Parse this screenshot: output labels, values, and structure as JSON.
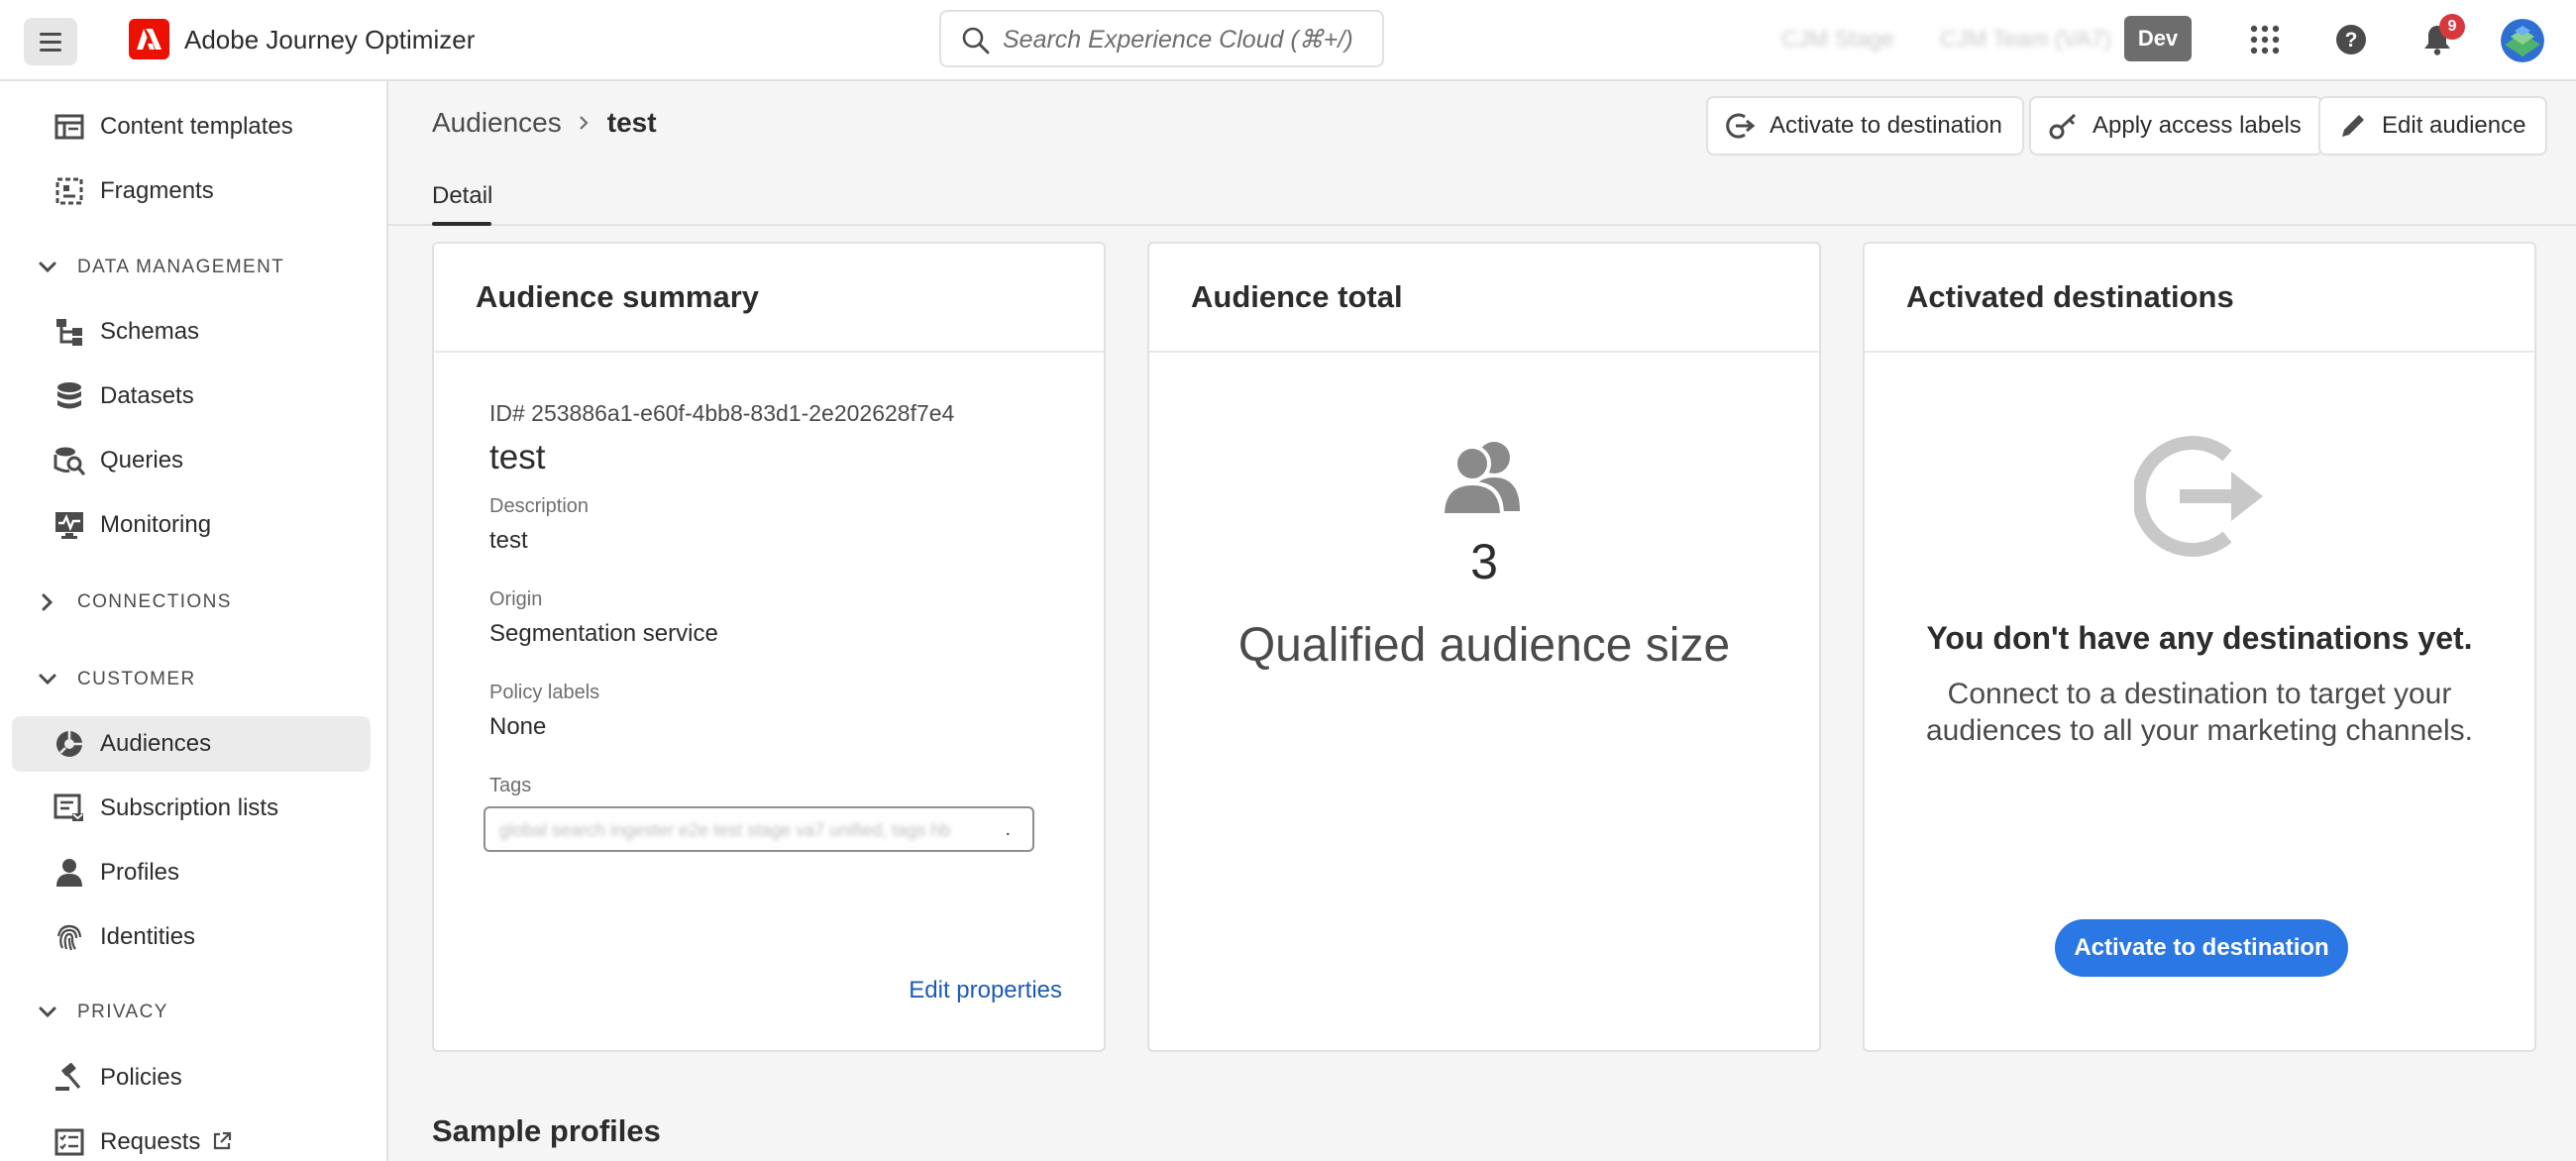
{
  "app": {
    "name": "Adobe Journey Optimizer"
  },
  "topbar": {
    "search_placeholder": "Search Experience Cloud (⌘+/)",
    "org_primary": "CJM Stage",
    "org_secondary": "CJM Team (VA7)",
    "environment": "Dev",
    "notification_count": "9",
    "icons": [
      "menu-icon",
      "adobe-logo-icon",
      "search-icon",
      "apps-grid-icon",
      "help-icon",
      "notification-bell-icon",
      "user-avatar-icon"
    ]
  },
  "sidebar": {
    "items_top": [
      {
        "label": "Content templates",
        "icon": "content-templates-icon"
      },
      {
        "label": "Fragments",
        "icon": "fragments-icon"
      }
    ],
    "sections": [
      {
        "label": "DATA MANAGEMENT",
        "expanded": true
      },
      {
        "label": "CONNECTIONS",
        "expanded": false
      },
      {
        "label": "CUSTOMER",
        "expanded": true
      },
      {
        "label": "PRIVACY",
        "expanded": true
      }
    ],
    "data_management": [
      {
        "label": "Schemas",
        "icon": "schemas-icon"
      },
      {
        "label": "Datasets",
        "icon": "datasets-icon"
      },
      {
        "label": "Queries",
        "icon": "queries-icon"
      },
      {
        "label": "Monitoring",
        "icon": "monitoring-icon"
      }
    ],
    "customer": [
      {
        "label": "Audiences",
        "icon": "audiences-icon",
        "active": true
      },
      {
        "label": "Subscription lists",
        "icon": "subscription-lists-icon"
      },
      {
        "label": "Profiles",
        "icon": "profiles-icon"
      },
      {
        "label": "Identities",
        "icon": "identities-icon"
      }
    ],
    "privacy": [
      {
        "label": "Policies",
        "icon": "policies-icon"
      },
      {
        "label": "Requests",
        "icon": "requests-icon"
      }
    ]
  },
  "breadcrumb": {
    "parent": "Audiences",
    "current": "test"
  },
  "actions": {
    "activate": "Activate to destination",
    "apply_labels": "Apply access labels",
    "edit_audience": "Edit audience"
  },
  "tabs": [
    {
      "label": "Detail",
      "selected": true
    }
  ],
  "summary": {
    "title": "Audience summary",
    "id": "ID# 253886a1-e60f-4bb8-83d1-2e202628f7e4",
    "name": "test",
    "description_label": "Description",
    "description_value": "test",
    "origin_label": "Origin",
    "origin_value": "Segmentation service",
    "policy_label": "Policy labels",
    "policy_value": "None",
    "tags_label": "Tags",
    "tags_value": "global search ingester e2e test stage va7 unified, tags hb",
    "tags_more": ".",
    "edit_link": "Edit properties"
  },
  "total": {
    "title": "Audience total",
    "count": "3",
    "label": "Qualified audience size"
  },
  "destinations": {
    "title": "Activated destinations",
    "empty_title": "You don't have any destinations yet.",
    "empty_desc": "Connect to a destination to target your audiences to all your marketing channels.",
    "button": "Activate to destination"
  },
  "sample_profiles": {
    "title": "Sample profiles"
  },
  "colors": {
    "accent": "#2b78e4",
    "link": "#1d5bb5",
    "adobe_red": "#eb1000",
    "badge_red": "#d7373f"
  }
}
